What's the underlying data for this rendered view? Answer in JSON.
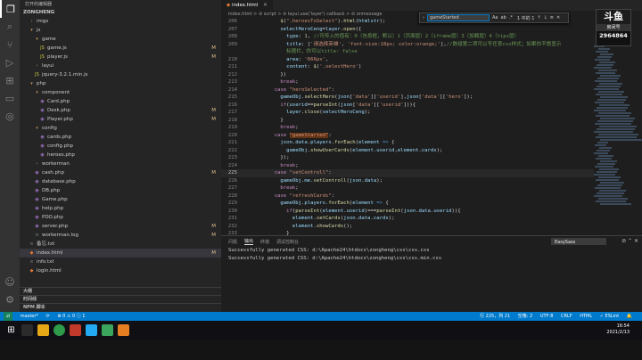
{
  "sidebar": {
    "title": "打开的编辑器",
    "root": "ZONGHENG",
    "tree": [
      {
        "label": "imgs",
        "type": "fold",
        "indent": 1
      },
      {
        "label": "js",
        "type": "fold",
        "indent": 1,
        "open": true
      },
      {
        "label": "game",
        "type": "fold",
        "indent": 2,
        "open": true
      },
      {
        "label": "game.js",
        "type": "js",
        "indent": 3,
        "mark": "M"
      },
      {
        "label": "player.js",
        "type": "js",
        "indent": 3,
        "mark": "M"
      },
      {
        "label": "layui",
        "type": "fold",
        "indent": 2
      },
      {
        "label": "jquery-3.2.1.min.js",
        "type": "js",
        "indent": 2
      },
      {
        "label": "php",
        "type": "fold",
        "indent": 1,
        "open": true
      },
      {
        "label": "component",
        "type": "fold",
        "indent": 2,
        "open": true
      },
      {
        "label": "Card.php",
        "type": "php",
        "indent": 3
      },
      {
        "label": "Desk.php",
        "type": "php",
        "indent": 3,
        "mark": "M"
      },
      {
        "label": "Player.php",
        "type": "php",
        "indent": 3,
        "mark": "M"
      },
      {
        "label": "config",
        "type": "fold",
        "indent": 2,
        "open": true
      },
      {
        "label": "cards.php",
        "type": "php",
        "indent": 3
      },
      {
        "label": "config.php",
        "type": "php",
        "indent": 3
      },
      {
        "label": "heroes.php",
        "type": "php",
        "indent": 3
      },
      {
        "label": "workerman",
        "type": "fold",
        "indent": 2
      },
      {
        "label": "cash.php",
        "type": "php",
        "indent": 2,
        "mark": "M"
      },
      {
        "label": "database.php",
        "type": "php",
        "indent": 2
      },
      {
        "label": "DB.php",
        "type": "php",
        "indent": 2
      },
      {
        "label": "Game.php",
        "type": "php",
        "indent": 2
      },
      {
        "label": "help.php",
        "type": "php",
        "indent": 2
      },
      {
        "label": "PDO.php",
        "type": "php",
        "indent": 2
      },
      {
        "label": "server.php",
        "type": "php",
        "indent": 2,
        "mark": "M"
      },
      {
        "label": "workerman.log",
        "type": "txt",
        "indent": 2,
        "mark": "M"
      },
      {
        "label": "备忘.txt",
        "type": "txt",
        "indent": 1
      },
      {
        "label": "index.html",
        "type": "htm",
        "indent": 1,
        "mark": "M",
        "selected": true
      },
      {
        "label": "info.txt",
        "type": "txt",
        "indent": 1
      },
      {
        "label": "login.html",
        "type": "htm",
        "indent": 1
      }
    ],
    "sections": [
      "大纲",
      "时间线",
      "NPM 脚本"
    ]
  },
  "tab": {
    "label": "index.html"
  },
  "breadcrumb": "index.html > ⊘ script > ⊘ layui.use('layer') callback > ⊘ onmessage",
  "find": {
    "value": "gameStarted",
    "options": [
      "Aa",
      "ab",
      ".*"
    ],
    "count": "1 中的 1"
  },
  "editor": {
    "lines": [
      {
        "n": "206",
        "html": "            <span class='f'>$</span><span class='p'>(</span><span class='s'>\".heroesToSelect\"</span><span class='p'>).</span><span class='f'>html</span><span class='p'>(</span><span class='v'>htmlstr</span><span class='p'>);</span>"
      },
      {
        "n": "207",
        "html": "            <span class='v'>selectHeroCeng</span><span class='p'>=</span><span class='v'>layer</span><span class='p'>.</span><span class='f'>open</span><span class='p'>({</span>"
      },
      {
        "n": "208",
        "html": "              <span class='v'>type</span><span class='p'>: </span><span class='n'>1</span><span class='p'>, </span><span class='c'>//可传入的值有：0（信息框，默认）1（页面层）2（iframe层）3（加载层）4（tips层）</span>"
      },
      {
        "n": "209",
        "html": "              <span class='v'>title</span><span class='p'>: [</span><span class='s'>'请选择英雄'</span><span class='p'>, </span><span class='s'>'font-size:18px; color:orange;'</span><span class='p'>],</span><span class='c'>//数组第二项可以写任意css样式；如果你不想显示</span>"
      },
      {
        "n": "",
        "html": "              <span class='c'>标题栏，你可以title: false</span>"
      },
      {
        "n": "210",
        "html": "              <span class='v'>area</span><span class='p'>: </span><span class='s'>'666px'</span><span class='p'>,</span>"
      },
      {
        "n": "211",
        "html": "              <span class='v'>content</span><span class='p'>: </span><span class='f'>$</span><span class='p'>(</span><span class='s'>'.selectHero'</span><span class='p'>)</span>"
      },
      {
        "n": "212",
        "html": "            <span class='p'>})</span>"
      },
      {
        "n": "213",
        "html": "            <span class='k'>break</span><span class='p'>;</span>"
      },
      {
        "n": "214",
        "html": "          <span class='k'>case</span> <span class='s'>\"heroSelected\"</span><span class='p'>:</span>"
      },
      {
        "n": "215",
        "html": "            <span class='v'>gameObj</span><span class='p'>.</span><span class='f'>selectHero</span><span class='p'>(</span><span class='v'>json</span><span class='p'>[</span><span class='s'>'data'</span><span class='p'>][</span><span class='s'>'userid'</span><span class='p'>],</span><span class='v'>json</span><span class='p'>[</span><span class='s'>'data'</span><span class='p'>][</span><span class='s'>'hero'</span><span class='p'>]);</span>"
      },
      {
        "n": "216",
        "html": "            <span class='k'>if</span><span class='p'>(</span><span class='v'>userid</span><span class='p'>==</span><span class='f'>parseInt</span><span class='p'>(</span><span class='v'>json</span><span class='p'>[</span><span class='s'>'data'</span><span class='p'>][</span><span class='s'>'userid'</span><span class='p'>])){</span>"
      },
      {
        "n": "217",
        "html": "              <span class='v'>layer</span><span class='p'>.</span><span class='f'>close</span><span class='p'>(</span><span class='v'>selectHeroCeng</span><span class='p'>);</span>"
      },
      {
        "n": "218",
        "html": "            <span class='p'>}</span>"
      },
      {
        "n": "219",
        "html": "            <span class='k'>break</span><span class='p'>;</span>"
      },
      {
        "n": "220",
        "html": "          <span class='k'>case</span> <span class='s hl'>\"gameStarted\"</span><span class='p'>:</span>"
      },
      {
        "n": "221",
        "html": "            <span class='v'>json</span><span class='p'>.</span><span class='v'>data</span><span class='p'>.</span><span class='v'>players</span><span class='p'>.</span><span class='f'>forEach</span><span class='p'>(</span><span class='v'>element</span> <span class='b'>=&gt;</span> <span class='p'>{</span>"
      },
      {
        "n": "222",
        "html": "              <span class='v'>gameObj</span><span class='p'>.</span><span class='f'>showUserCards</span><span class='p'>(</span><span class='v'>element</span><span class='p'>.</span><span class='v'>userid</span><span class='p'>,</span><span class='v'>element</span><span class='p'>.</span><span class='v'>cards</span><span class='p'>);</span>"
      },
      {
        "n": "223",
        "html": "            <span class='p'>});</span>"
      },
      {
        "n": "224",
        "html": "            <span class='k'>break</span><span class='p'>;</span>"
      },
      {
        "n": "225",
        "html": "          <span class='k'>case</span> <span class='s'>\"setControll\"</span><span class='p'>:</span>",
        "current": true
      },
      {
        "n": "226",
        "html": "            <span class='v'>gameObj</span><span class='p'>.</span><span class='v'>me</span><span class='p'>.</span><span class='f'>setControll</span><span class='p'>(</span><span class='v'>json</span><span class='p'>.</span><span class='v'>data</span><span class='p'>);</span>"
      },
      {
        "n": "227",
        "html": "            <span class='k'>break</span><span class='p'>;</span>"
      },
      {
        "n": "228",
        "html": "          <span class='k'>case</span> <span class='s'>\"refreshCards\"</span><span class='p'>:</span>"
      },
      {
        "n": "229",
        "html": "            <span class='v'>gameObj</span><span class='p'>.</span><span class='v'>players</span><span class='p'>.</span><span class='f'>forEach</span><span class='p'>(</span><span class='v'>element</span> <span class='b'>=&gt;</span> <span class='p'>{</span>"
      },
      {
        "n": "230",
        "html": "              <span class='k'>if</span><span class='p'>(</span><span class='f'>parseInt</span><span class='p'>(</span><span class='v'>element</span><span class='p'>.</span><span class='v'>userid</span><span class='p'>)===</span><span class='f'>parseInt</span><span class='p'>(</span><span class='v'>json</span><span class='p'>.</span><span class='v'>data</span><span class='p'>.</span><span class='v'>userid</span><span class='p'>)){</span>"
      },
      {
        "n": "231",
        "html": "                <span class='v'>element</span><span class='p'>.</span><span class='f'>setCards</span><span class='p'>(</span><span class='v'>json</span><span class='p'>.</span><span class='v'>data</span><span class='p'>.</span><span class='v'>cards</span><span class='p'>);</span>"
      },
      {
        "n": "232",
        "html": "                <span class='v'>element</span><span class='p'>.</span><span class='f'>showCards</span><span class='p'>();</span>"
      },
      {
        "n": "233",
        "html": "              <span class='p'>}</span>"
      },
      {
        "n": "234",
        "html": "            <span class='p'>});</span>"
      },
      {
        "n": "235",
        "html": ""
      },
      {
        "n": "236",
        "html": ""
      }
    ]
  },
  "stream": {
    "logo": "斗鱼",
    "sub": "房间号",
    "room": "2964864"
  },
  "panel": {
    "tabs": [
      "问题",
      "输出",
      "终端",
      "调试控制台"
    ],
    "active": 1,
    "select": "EasySass",
    "output": [
      "Successfully generated CSS: d:\\Apache24\\htdocs\\zongheng\\css\\css.css",
      "Successfully generated CSS: d:\\Apache24\\htdocs\\zongheng\\css\\css.min.css"
    ]
  },
  "status": {
    "branch": "master*",
    "sync": "⟳",
    "errors": "⊗ 0 ⚠ 0 ⓘ 1",
    "cursor": "行 225，列 21",
    "spaces": "空格: 2",
    "encoding": "UTF-8",
    "eol": "CRLF",
    "lang": "HTML",
    "lint": "✓ ESLint"
  },
  "taskbar": {
    "time": "16:54",
    "date": "2021/2/13"
  },
  "colors": {
    "accent": "#007acc",
    "taskbar": "#0f0f14"
  }
}
